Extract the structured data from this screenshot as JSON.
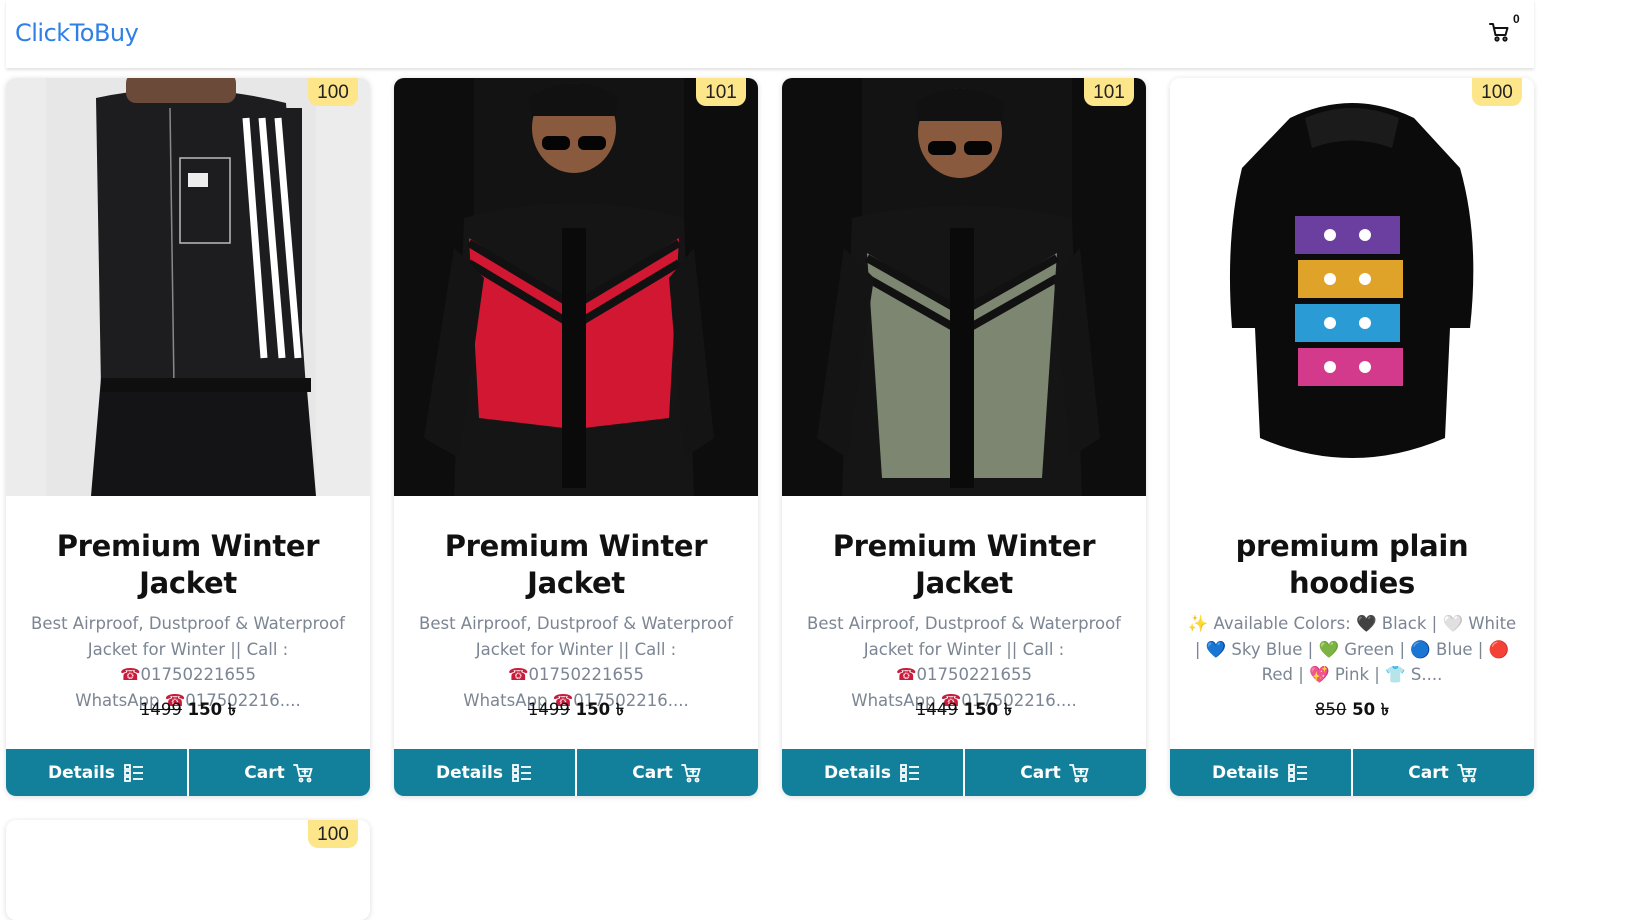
{
  "brand": "ClickToBuy",
  "nav": {
    "cart_count": "0"
  },
  "currency": "৳",
  "products": [
    {
      "badge": "100",
      "title": "Premium Winter Jacket",
      "desc_line1": "Best Airproof, Dustproof & Waterproof",
      "desc_line2a": "Jacket for Winter || Call : ",
      "desc_line2b": "01750221655",
      "desc_line3a": "WhatsApp ",
      "desc_line3b": "017502216....",
      "old_price": "1499",
      "price": "150",
      "details_label": "Details",
      "cart_label": "Cart"
    },
    {
      "badge": "101",
      "title": "Premium Winter Jacket",
      "desc_line1": "Best Airproof, Dustproof & Waterproof",
      "desc_line2a": "Jacket for Winter || Call : ",
      "desc_line2b": "01750221655",
      "desc_line3a": "WhatsApp ",
      "desc_line3b": "017502216....",
      "old_price": "1499",
      "price": "150",
      "details_label": "Details",
      "cart_label": "Cart"
    },
    {
      "badge": "101",
      "title": "Premium Winter Jacket",
      "desc_line1": "Best Airproof, Dustproof & Waterproof",
      "desc_line2a": "Jacket for Winter || Call : ",
      "desc_line2b": "01750221655",
      "desc_line3a": "WhatsApp ",
      "desc_line3b": "017502216....",
      "old_price": "1449",
      "price": "150",
      "details_label": "Details",
      "cart_label": "Cart"
    },
    {
      "badge": "100",
      "title": "premium plain hoodies",
      "desc_line1": "✨ Available Colors: 🖤 Black | 🤍 White",
      "desc_line2": "| 💙 Sky Blue | 💚 Green | 🔵 Blue | 🔴",
      "desc_line3": "Red | 💖 Pink | 👕 S....",
      "old_price": "850",
      "price": "50",
      "details_label": "Details",
      "cart_label": "Cart"
    }
  ],
  "next_row_badge": "100",
  "colors": {
    "brand": "#2f7fe6",
    "button": "#12809a",
    "badge": "#fde68a",
    "description": "#7b8593"
  }
}
